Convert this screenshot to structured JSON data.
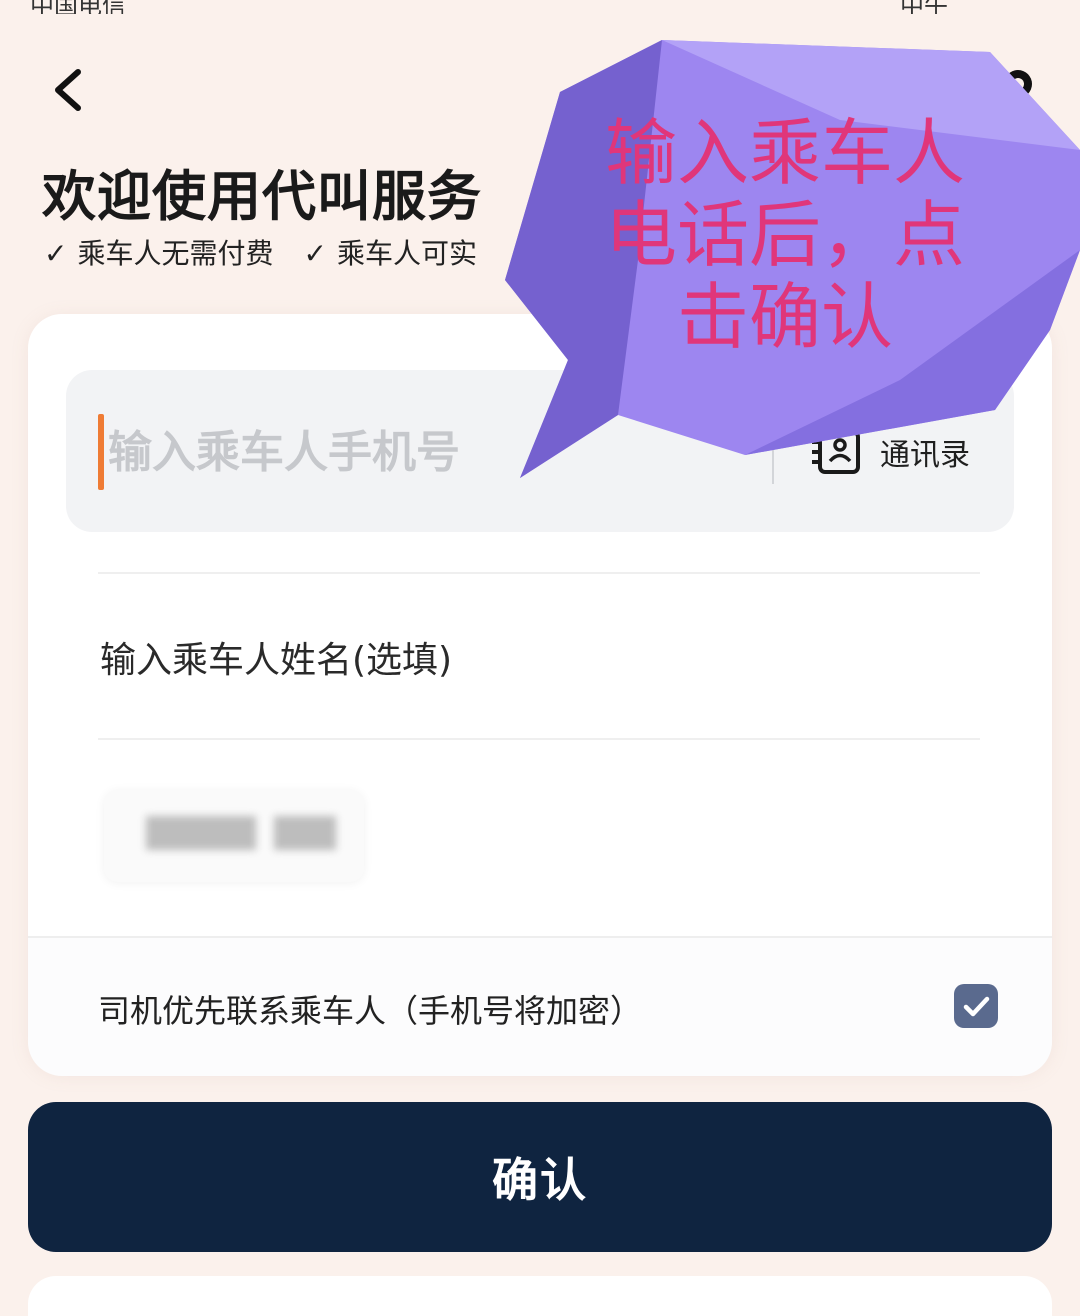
{
  "status_bar": {
    "carrier": "中国电信",
    "time": "中午"
  },
  "header": {
    "title": "欢迎使用代叫服务",
    "perks": [
      {
        "text": "乘车人无需付费"
      },
      {
        "text": "乘车人可实"
      }
    ]
  },
  "form": {
    "phone_placeholder": "输入乘车人手机号",
    "contacts_label": "通讯录",
    "name_placeholder": "输入乘车人姓名(选填)",
    "priority_contact_label": "司机优先联系乘车人（手机号将加密）",
    "priority_contact_checked": true
  },
  "confirm_label": "确认",
  "annotation": {
    "line1": "输入乘车人",
    "line2": "电话后，点",
    "line3": "击确认"
  },
  "colors": {
    "accent_caret": "#ef7b34",
    "button_bg": "#0f2440",
    "checkbox_bg": "#5a6a8e",
    "annotation_text": "#e0367a",
    "bubble": "#9d86f0"
  }
}
